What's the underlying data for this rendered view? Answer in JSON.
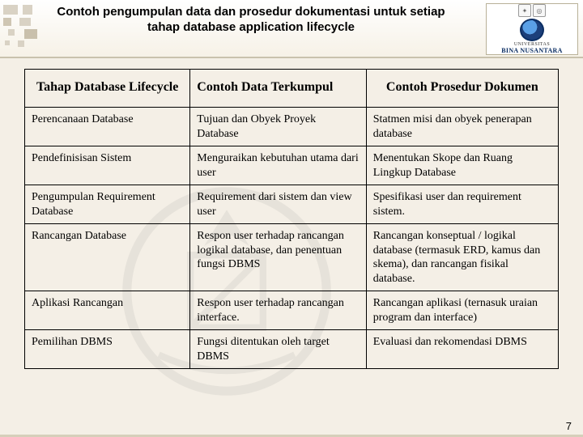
{
  "title": "Contoh pengumpulan data dan prosedur dokumentasi untuk setiap tahap database application lifecycle",
  "logo": {
    "line1": "UNIVERSITAS",
    "line2": "BINA NUSANTARA"
  },
  "table": {
    "headers": [
      "Tahap Database Lifecycle",
      "Contoh Data Terkumpul",
      "Contoh Prosedur Dokumen"
    ],
    "rows": [
      {
        "c1": "Perencanaan Database",
        "c2": "Tujuan dan Obyek Proyek Database",
        "c3": "Statmen misi dan obyek penerapan database"
      },
      {
        "c1": "Pendefinisisan Sistem",
        "c2": "Menguraikan kebutuhan utama dari user",
        "c3": "Menentukan Skope dan Ruang Lingkup Database"
      },
      {
        "c1": "Pengumpulan Requirement Database",
        "c2": "Requirement dari sistem dan view user",
        "c3": "Spesifikasi user dan requirement sistem."
      },
      {
        "c1": "Rancangan Database",
        "c2": "Respon user terhadap rancangan logikal database, dan penentuan fungsi DBMS",
        "c3": "Rancangan konseptual / logikal database (termasuk ERD, kamus dan skema), dan rancangan fisikal database."
      },
      {
        "c1": "Aplikasi Rancangan",
        "c2": "Respon user terhadap rancangan interface.",
        "c3": "Rancangan aplikasi (ternasuk uraian program dan interface)"
      },
      {
        "c1": "Pemilihan DBMS",
        "c2": "Fungsi ditentukan oleh target DBMS",
        "c3": "Evaluasi dan rekomendasi DBMS"
      }
    ]
  },
  "page_number": "7"
}
